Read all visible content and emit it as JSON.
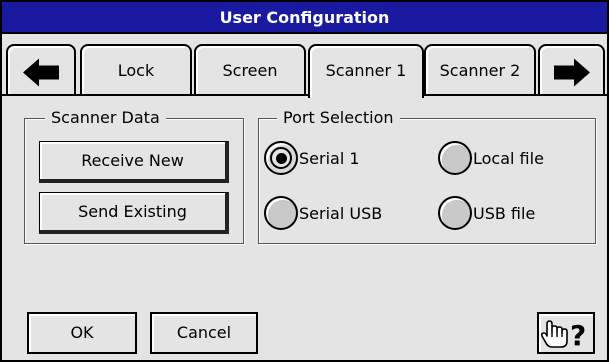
{
  "window": {
    "title": "User Configuration"
  },
  "tabs": {
    "prev_icon": "left-arrow-icon",
    "next_icon": "right-arrow-icon",
    "items": [
      {
        "label": "Lock"
      },
      {
        "label": "Screen"
      },
      {
        "label": "Scanner 1",
        "active": true
      },
      {
        "label": "Scanner 2"
      }
    ]
  },
  "scanner_data": {
    "legend": "Scanner Data",
    "receive_label": "Receive New",
    "send_label": "Send Existing"
  },
  "port_selection": {
    "legend": "Port Selection",
    "options": [
      {
        "label": "Serial 1",
        "selected": true
      },
      {
        "label": "Local file",
        "selected": false
      },
      {
        "label": "Serial USB",
        "selected": false
      },
      {
        "label": "USB file",
        "selected": false
      }
    ]
  },
  "footer": {
    "ok_label": "OK",
    "cancel_label": "Cancel",
    "help_icon": "pointing-hand-question-icon"
  },
  "colors": {
    "titlebar": "#1a1aa0",
    "background": "#e4e4e4"
  }
}
